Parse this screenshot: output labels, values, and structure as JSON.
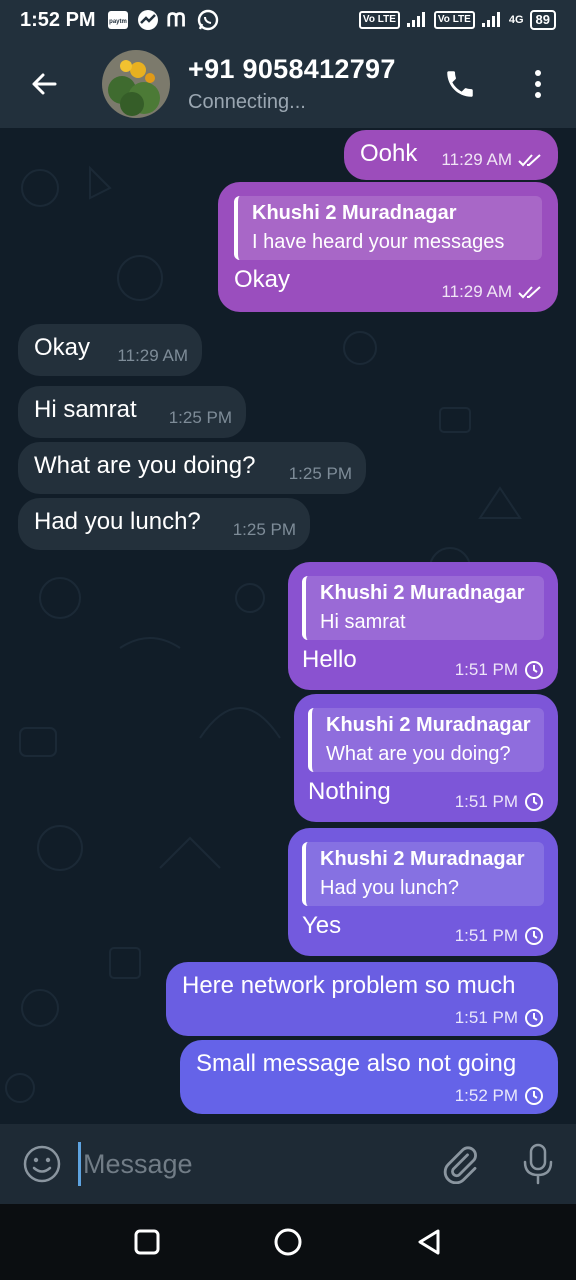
{
  "status_bar": {
    "time": "1:52 PM",
    "app_icons": [
      "paytm-icon",
      "chart-icon",
      "m-icon",
      "whatsapp-icon"
    ],
    "volte1": "Vo LTE",
    "volte2": "Vo LTE",
    "network": "4G",
    "battery": "89"
  },
  "header": {
    "contact_name": "+91 9058412797",
    "status": "Connecting..."
  },
  "messages": [
    {
      "dir": "out",
      "text": "Oohk",
      "time": "11:29 AM",
      "tick": "double-check-icon"
    },
    {
      "dir": "out",
      "reply_name": "Khushi 2 Muradnagar",
      "reply_text": "I have heard your messages",
      "text": "Okay",
      "time": "11:29 AM",
      "tick": "double-check-icon"
    },
    {
      "dir": "in",
      "text": "Okay",
      "time": "11:29 AM"
    },
    {
      "dir": "in",
      "text": "Hi samrat",
      "time": "1:25 PM"
    },
    {
      "dir": "in",
      "text": "What are you doing?",
      "time": "1:25 PM"
    },
    {
      "dir": "in",
      "text": "Had you lunch?",
      "time": "1:25 PM"
    },
    {
      "dir": "out",
      "reply_name": "Khushi 2 Muradnagar",
      "reply_text": "Hi samrat",
      "text": "Hello",
      "time": "1:51 PM",
      "tick": "clock-icon"
    },
    {
      "dir": "out",
      "reply_name": "Khushi 2 Muradnagar",
      "reply_text": "What are you doing?",
      "text": "Nothing",
      "time": "1:51 PM",
      "tick": "clock-icon"
    },
    {
      "dir": "out",
      "reply_name": "Khushi 2 Muradnagar",
      "reply_text": "Had you lunch?",
      "text": "Yes",
      "time": "1:51 PM",
      "tick": "clock-icon"
    },
    {
      "dir": "out",
      "text": "Here network problem so much",
      "time": "1:51 PM",
      "tick": "clock-icon"
    },
    {
      "dir": "out",
      "text": "Small message also not going",
      "time": "1:52 PM",
      "tick": "clock-icon"
    }
  ],
  "input": {
    "placeholder": "Message",
    "value": ""
  },
  "colors": {
    "header_bg": "#22303c",
    "chat_bg": "#111d28",
    "incoming_bubble": "#23303b",
    "outgoing_top": "#9b4fbe",
    "outgoing_bottom": "#6c63e6"
  }
}
